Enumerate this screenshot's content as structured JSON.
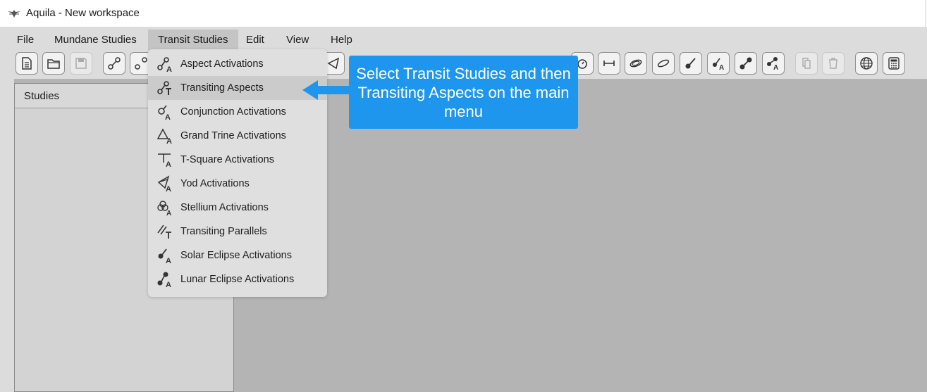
{
  "window": {
    "title": "Aquila - New workspace",
    "app_icon": "eagle-icon"
  },
  "menubar": {
    "items": [
      {
        "label": "File"
      },
      {
        "label": "Mundane Studies"
      },
      {
        "label": "Transit Studies",
        "active": true
      },
      {
        "label": "Edit"
      },
      {
        "label": "View"
      },
      {
        "label": "Help"
      }
    ]
  },
  "toolbar": {
    "icons": [
      "new-document-icon",
      "open-folder-icon",
      "save-icon",
      "aspect-icon",
      "aspect-activation-icon",
      "yod-icon",
      "timer-icon",
      "parallel-bar-icon",
      "orbit-icon",
      "eclipse-path-icon",
      "solar-eclipse-icon",
      "solar-eclipse-activation-icon",
      "lunar-eclipse-icon",
      "lunar-eclipse-activation-icon",
      "copy-icon",
      "delete-icon",
      "globe-icon",
      "calculator-icon"
    ]
  },
  "studies_panel": {
    "header": "Studies"
  },
  "dropdown": {
    "items": [
      {
        "label": "Aspect Activations",
        "icon": "aspect-activations-icon"
      },
      {
        "label": "Transiting Aspects",
        "icon": "transiting-aspects-icon",
        "highlighted": true
      },
      {
        "label": "Conjunction Activations",
        "icon": "conjunction-activations-icon"
      },
      {
        "label": "Grand Trine Activations",
        "icon": "grand-trine-activations-icon"
      },
      {
        "label": "T-Square Activations",
        "icon": "t-square-activations-icon"
      },
      {
        "label": "Yod Activations",
        "icon": "yod-activations-icon"
      },
      {
        "label": "Stellium Activations",
        "icon": "stellium-activations-icon"
      },
      {
        "label": "Transiting Parallels",
        "icon": "transiting-parallels-icon"
      },
      {
        "label": "Solar Eclipse Activations",
        "icon": "solar-eclipse-activations-icon"
      },
      {
        "label": "Lunar Eclipse Activations",
        "icon": "lunar-eclipse-activations-icon"
      }
    ]
  },
  "callout": {
    "text": "Select Transit Studies and then Transiting Aspects on the main menu"
  },
  "colors": {
    "callout": "#1e96ee",
    "workspace": "#b4b4b4",
    "menubar": "#dcdcdc"
  }
}
